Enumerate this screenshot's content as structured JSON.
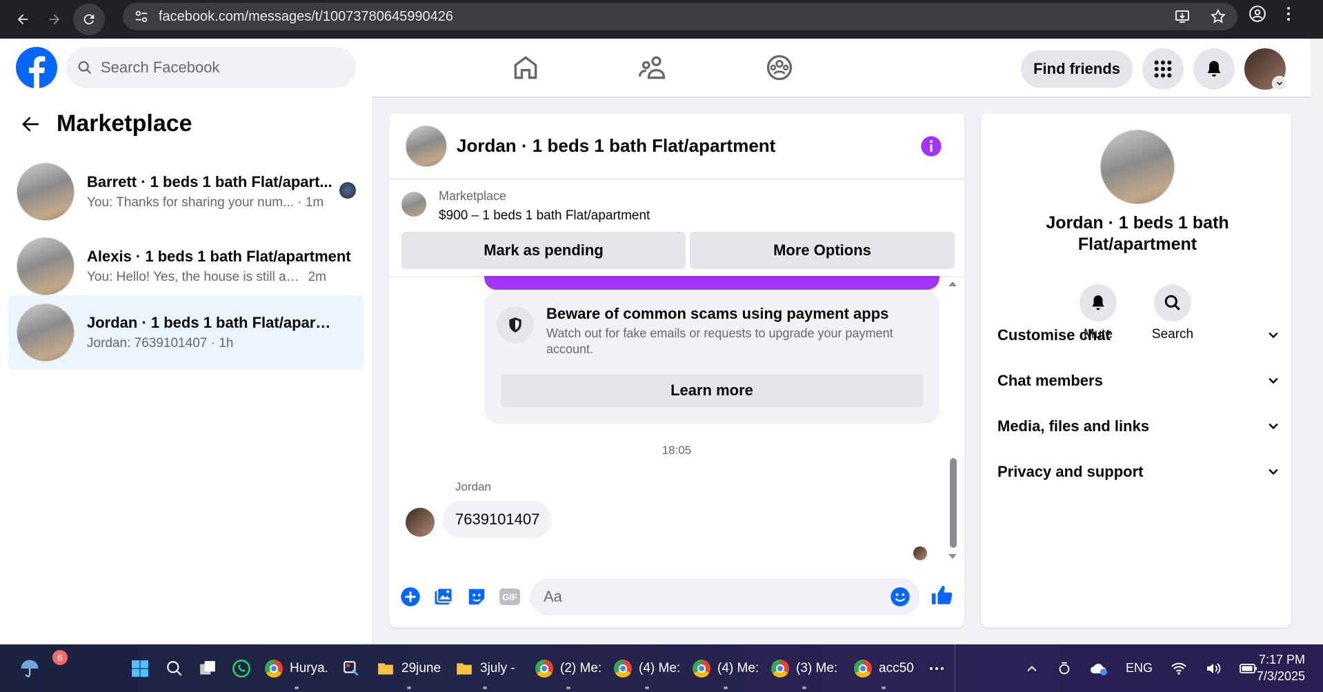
{
  "browser": {
    "url": "facebook.com/messages/t/10073780645990426"
  },
  "header": {
    "search_placeholder": "Search Facebook",
    "find_friends": "Find friends"
  },
  "sidebar": {
    "title": "Marketplace",
    "threads": [
      {
        "name": "Barrett · 1 beds 1 bath Flat/apart...",
        "preview": "You: Thanks for sharing your num...",
        "time": "· 1m"
      },
      {
        "name": "Alexis · 1 beds 1 bath Flat/apartment",
        "preview": "You: Hello! Yes, the house is still avail...",
        "time": "2m"
      },
      {
        "name": "Jordan · 1 beds 1 bath Flat/apartm...",
        "preview": "Jordan: 7639101407",
        "time": "· 1h"
      }
    ]
  },
  "chat": {
    "title": "Jordan · 1 beds 1 bath Flat/apartment",
    "listing": {
      "label": "Marketplace",
      "price": "$900 – 1 beds 1 bath Flat/apartment",
      "pending_button": "Mark as pending",
      "options_button": "More Options"
    },
    "scam_notice": {
      "title": "Beware of common scams using payment apps",
      "body": "Watch out for fake emails or requests to upgrade your payment account.",
      "button": "Learn more"
    },
    "timestamp": "18:05",
    "sender": "Jordan",
    "message": "7639101407",
    "composer_placeholder": "Aa"
  },
  "info": {
    "name": "Jordan · 1 beds 1 bath Flat/apartment",
    "actions": [
      "Mute",
      "Search"
    ],
    "sections": [
      "Customise chat",
      "Chat members",
      "Media, files and links",
      "Privacy and support"
    ]
  },
  "taskbar": {
    "badge": "6",
    "items": [
      {
        "label": "Hurya."
      },
      {
        "label": "29june"
      },
      {
        "label": "3july -"
      },
      {
        "label": "(2) Me:"
      },
      {
        "label": "(4) Me:"
      },
      {
        "label": "(4) Me:"
      },
      {
        "label": "(3) Me:"
      },
      {
        "label": "acc50"
      }
    ],
    "language": "ENG",
    "time": "7:17 PM",
    "date": "7/3/2025"
  },
  "colors": {
    "brand": "#0866ff",
    "purple": "#a334fa"
  }
}
